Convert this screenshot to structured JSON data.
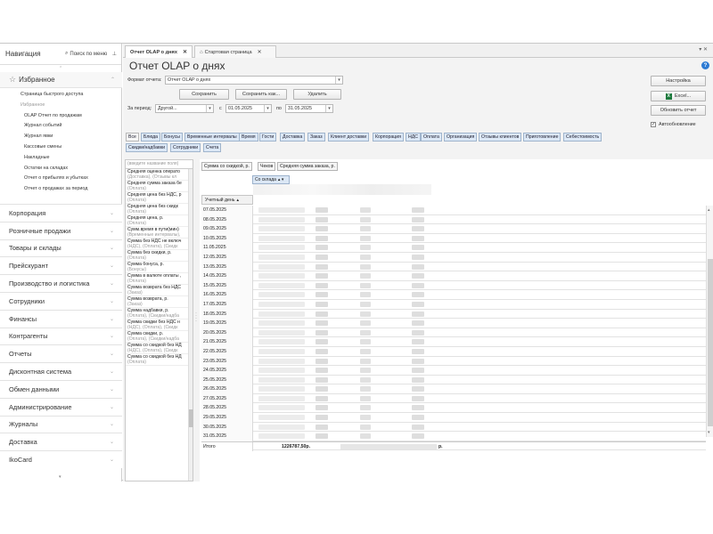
{
  "nav": {
    "title": "Навигация",
    "search": "Поиск по меню",
    "favorites_label": "Избранное",
    "favorites": [
      {
        "label": "Страница быстрого доступа",
        "level": 1,
        "grey": false
      },
      {
        "label": "Избранное",
        "level": 1,
        "grey": true
      },
      {
        "label": "OLAP Отчет по продажам",
        "level": 2,
        "grey": false
      },
      {
        "label": "Журнал событий",
        "level": 2,
        "grey": false
      },
      {
        "label": "Журнал явки",
        "level": 2,
        "grey": false
      },
      {
        "label": "Кассовые смены",
        "level": 2,
        "grey": false
      },
      {
        "label": "Накладные",
        "level": 2,
        "grey": false
      },
      {
        "label": "Остатки на складах",
        "level": 2,
        "grey": false
      },
      {
        "label": "Отчет о прибылях и убытках",
        "level": 2,
        "grey": false
      },
      {
        "label": "Отчет о продажах за период",
        "level": 2,
        "grey": false
      }
    ],
    "groups": [
      "Корпорация",
      "Розничные продажи",
      "Товары и склады",
      "Прейскурант",
      "Производство и логистика",
      "Сотрудники",
      "Финансы",
      "Контрагенты",
      "Отчеты",
      "Дисконтная система",
      "Обмен данными",
      "Администрирование",
      "Журналы",
      "Доставка",
      "IkoCard"
    ]
  },
  "tabs": [
    {
      "label": "Отчет OLAP о днях",
      "active": true,
      "icon": ""
    },
    {
      "label": "Стартовая страница",
      "active": false,
      "icon": "home-icon"
    }
  ],
  "page": {
    "title": "Отчет OLAP о днях",
    "format_label": "Формат отчета:",
    "format_value": "Отчет OLAP о днях",
    "save": "Сохранить",
    "save_as": "Сохранить как...",
    "delete": "Удалить",
    "period_label": "За период:",
    "period_value": "Другой...",
    "from_label": "с",
    "from_value": "01.05.2025",
    "to_label": "по",
    "to_value": "31.05.2025",
    "settings": "Настройка",
    "excel": "Excel...",
    "refresh": "Обновить отчет",
    "autorefresh": "Автообновление"
  },
  "filters_row1": [
    "Все",
    "Блюда",
    "Бонусы",
    "Временные интервалы",
    "Время",
    "Гости",
    "Доставка",
    "Заказ",
    "Клиент доставки",
    "Корпорация",
    "НДС",
    "Оплата",
    "Организация",
    "Отзывы клиентов",
    "Приготовление",
    "Себестоимость"
  ],
  "filters_row2": [
    "Скидки/надбавки",
    "Сотрудники",
    "Счета"
  ],
  "fields": {
    "search_placeholder": "(введите название поля)",
    "items": [
      {
        "name": "Средняя оценка операто",
        "sub": "(Доставка), (Отзывы кл"
      },
      {
        "name": "Средняя сумма заказа бе",
        "sub": "(Оплата)"
      },
      {
        "name": "Средняя цена без НДС, р",
        "sub": "(Оплата)"
      },
      {
        "name": "Средняя цена без скидк",
        "sub": "(Оплата)"
      },
      {
        "name": "Средняя цена, р.",
        "sub": "(Оплата)"
      },
      {
        "name": "Сумм.время в пути(мин)",
        "sub": "(Временные интервалы),"
      },
      {
        "name": "Сумма без НДС не включ",
        "sub": "(НДС), (Оплата), (Скидк"
      },
      {
        "name": "Сумма без скидки, р.",
        "sub": "(Оплата)"
      },
      {
        "name": "Сумма бонуса, р.",
        "sub": "(Бонусы)"
      },
      {
        "name": "Сумма в валюте оплаты ,",
        "sub": "(Оплата)"
      },
      {
        "name": "Сумма возврата без НДС",
        "sub": "(Заказ)"
      },
      {
        "name": "Сумма возврата, р.",
        "sub": "(Заказ)"
      },
      {
        "name": "Сумма надбавки, р.",
        "sub": "(Оплата), (Скидки/надба"
      },
      {
        "name": "Сумма скидки без НДС н",
        "sub": "(НДС), (Оплата), (Скидк"
      },
      {
        "name": "Сумма скидки, р.",
        "sub": "(Оплата), (Скидки/надба"
      },
      {
        "name": "Сумма со скидкой без НД",
        "sub": "(НДС), (Оплата), (Скидк"
      },
      {
        "name": "Сумма со скидкой без НД",
        "sub": "(Оплата)"
      }
    ]
  },
  "pivot": {
    "data_fields": [
      "Сумма со скидкой, р.",
      "Чеков",
      "Средняя сумма заказа, р."
    ],
    "column_field": "Со склада",
    "row_field": "Учетный день",
    "dates": [
      "07.05.2025",
      "08.05.2025",
      "09.05.2025",
      "10.05.2025",
      "11.05.2025",
      "12.05.2025",
      "13.05.2025",
      "14.05.2025",
      "15.05.2025",
      "16.05.2025",
      "17.05.2025",
      "18.05.2025",
      "19.05.2025",
      "20.05.2025",
      "21.05.2025",
      "22.05.2025",
      "23.05.2025",
      "24.05.2025",
      "25.05.2025",
      "26.05.2025",
      "27.05.2025",
      "28.05.2025",
      "29.05.2025",
      "30.05.2025",
      "31.05.2025"
    ],
    "total_label": "Итого",
    "total_value": "1226787,50р.",
    "total_tail": "р."
  }
}
